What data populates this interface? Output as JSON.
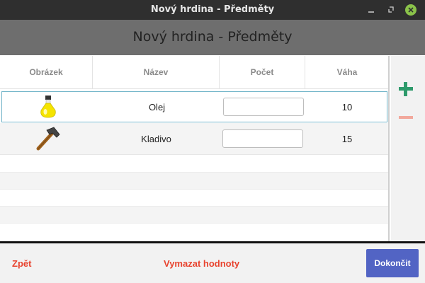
{
  "window": {
    "title": "Nový hrdina - Předměty",
    "controls": [
      "minimize-icon",
      "maximize-icon",
      "close-icon"
    ],
    "close_color": "#8bc34a"
  },
  "header": {
    "title": "Nový hrdina - Předměty"
  },
  "table": {
    "columns": [
      "Obrázek",
      "Název",
      "Počet",
      "Váha"
    ],
    "rows": [
      {
        "icon": "oil-flask-icon",
        "name": "Olej",
        "count": "",
        "weight": "10",
        "selected": true
      },
      {
        "icon": "hammer-icon",
        "name": "Kladivo",
        "count": "",
        "weight": "15",
        "selected": false
      }
    ]
  },
  "side": {
    "add_icon": "plus-icon",
    "remove_icon": "minus-icon",
    "add_color": "#2e9a6b",
    "remove_color": "#f2a89c"
  },
  "footer": {
    "back_label": "Zpět",
    "clear_label": "Vymazat hodnoty",
    "finish_label": "Dokončit"
  },
  "colors": {
    "accent": "#5264c4",
    "link": "#e8432e",
    "header_bg": "#6e6e6e",
    "titlebar_bg": "#2f2f2f"
  }
}
